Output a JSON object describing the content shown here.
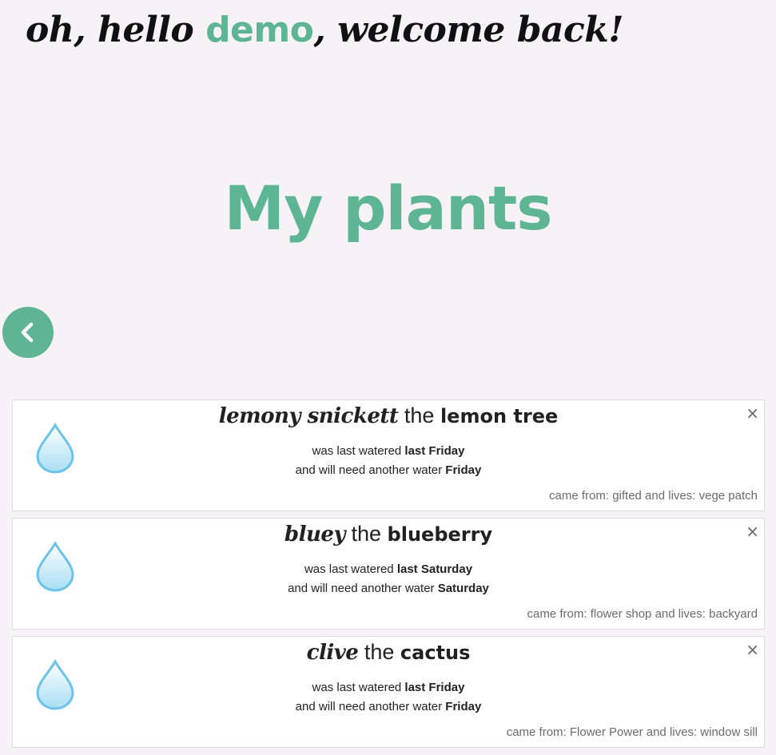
{
  "header": {
    "greeting_prefix": "oh, hello ",
    "username": "demo",
    "greeting_suffix": ", welcome back!"
  },
  "page_title": "My plants",
  "colors": {
    "accent": "#5db594",
    "background": "#f6f2f5",
    "water_drop": "#6cc3ea"
  },
  "icons": {
    "back": "chevron-left-icon",
    "water": "water-drop-icon",
    "delete": "close-icon"
  },
  "plants": [
    {
      "nickname": "lemony snickett",
      "connector": " the ",
      "species": "lemon tree",
      "watered_prefix": "was last watered ",
      "last_watered": "last Friday",
      "next_prefix": "and will need another water ",
      "next_water": "Friday",
      "came_from_label": "came from: ",
      "came_from": "gifted",
      "lives_label": " and lives: ",
      "lives": "vege patch",
      "close": "×"
    },
    {
      "nickname": "bluey",
      "connector": " the ",
      "species": "blueberry",
      "watered_prefix": "was last watered ",
      "last_watered": "last Saturday",
      "next_prefix": "and will need another water ",
      "next_water": "Saturday",
      "came_from_label": "came from: ",
      "came_from": "flower shop",
      "lives_label": " and lives: ",
      "lives": "backyard",
      "close": "×"
    },
    {
      "nickname": "clive",
      "connector": " the ",
      "species": "cactus",
      "watered_prefix": "was last watered ",
      "last_watered": "last Friday",
      "next_prefix": "and will need another water ",
      "next_water": "Friday",
      "came_from_label": "came from: ",
      "came_from": "Flower Power",
      "lives_label": " and lives: ",
      "lives": "window sill",
      "close": "×"
    }
  ]
}
